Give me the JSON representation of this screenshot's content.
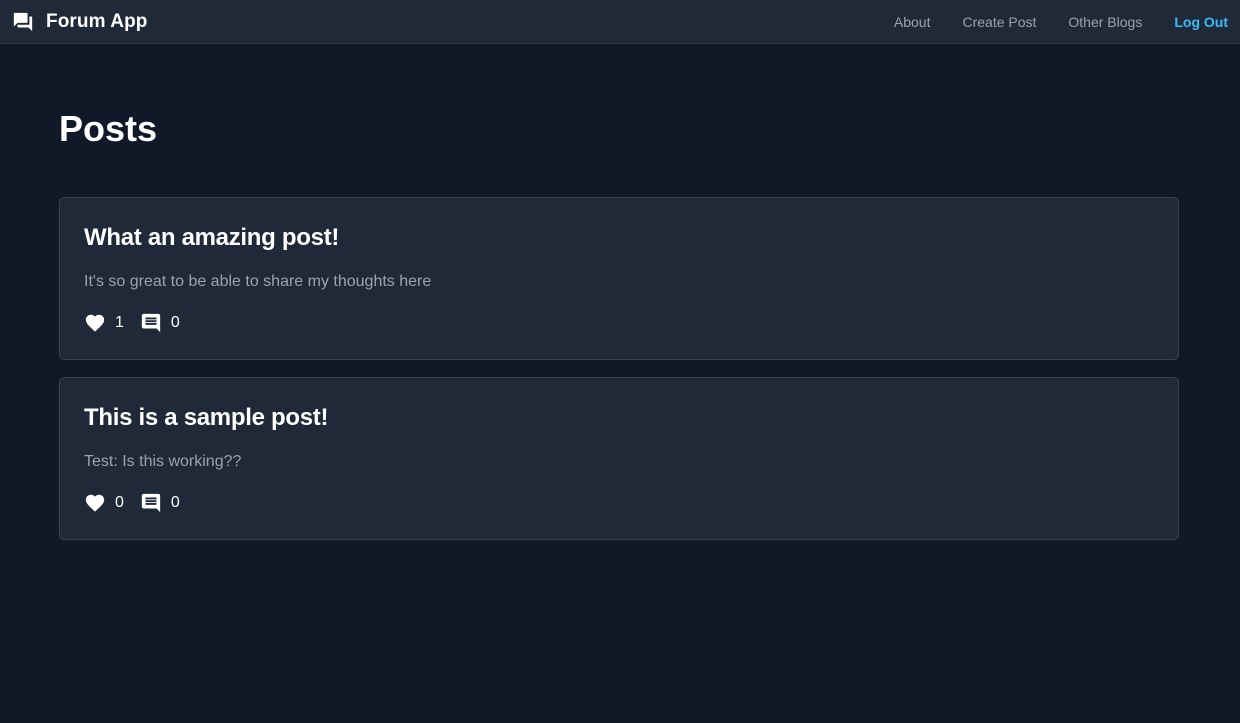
{
  "app": {
    "name": "Forum App",
    "brand_icon": "forum-chat-icon"
  },
  "nav": {
    "about": "About",
    "create_post": "Create Post",
    "other_blogs": "Other Blogs",
    "logout": "Log Out"
  },
  "page": {
    "title": "Posts"
  },
  "posts": [
    {
      "title": "What an amazing post!",
      "body": "It's so great to be able to share my thoughts here",
      "likes": "1",
      "comments": "0"
    },
    {
      "title": "This is a sample post!",
      "body": "Test: Is this working??",
      "likes": "0",
      "comments": "0"
    }
  ],
  "colors": {
    "background": "#111827",
    "navbar": "#1f2937",
    "card": "#1f2937",
    "card_border": "#374151",
    "muted_text": "#9ca3af",
    "accent": "#38bdf8"
  },
  "icons": {
    "like": "heart-icon",
    "comment": "comment-icon"
  }
}
